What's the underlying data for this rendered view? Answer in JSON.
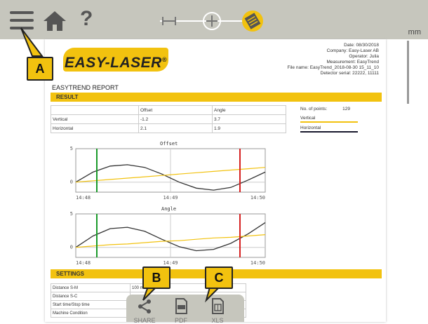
{
  "toolbar": {
    "menu_icon": "menu-icon",
    "home_icon": "home-icon",
    "help_label": "?",
    "unit": "mm"
  },
  "logo": {
    "text": "EASY-LASER",
    "reg": "®"
  },
  "header_info": {
    "date": "Date: 08/30/2018",
    "company": "Company: Easy-Laser AB",
    "operator": "Operator: Julia",
    "measurement": "Measurement: EasyTrend",
    "file": "File name: EasyTrend_2018-08-30 15_11_10",
    "serial": "Detector serial: 22222, 11111"
  },
  "report": {
    "title": "EASYTREND REPORT",
    "result_section": "RESULT",
    "settings_section": "SETTINGS"
  },
  "result_table": {
    "headers": [
      "",
      "Offset",
      "Angle"
    ],
    "rows": [
      [
        "Vertical",
        "-1.2",
        "3.7"
      ],
      [
        "Horizontal",
        "2.1",
        "1.9"
      ]
    ]
  },
  "points": {
    "label": "No. of points:",
    "value": "129",
    "legend_vertical": "Vertical",
    "legend_horizontal": "Horizontal",
    "vertical_color": "#f2c20f",
    "horizontal_color": "#1a1a2e"
  },
  "charts": {
    "offset_title": "Offset",
    "angle_title": "Angle",
    "y_ticks": [
      "5",
      "0"
    ],
    "x_ticks": [
      "14:48",
      "14:49",
      "14:50"
    ]
  },
  "chart_data": [
    {
      "type": "line",
      "title": "Offset",
      "xlabel": "",
      "ylabel": "",
      "x_ticks": [
        "14:48",
        "14:49",
        "14:50"
      ],
      "ylim": [
        -1.5,
        5
      ],
      "series": [
        {
          "values": [
            0.0,
            1.5,
            2.4,
            2.6,
            2.2,
            1.2,
            0.0,
            -0.9,
            -1.2,
            -0.8,
            0.3,
            1.5
          ],
          "color": "#333333"
        },
        {
          "values": [
            0.0,
            0.2,
            0.4,
            0.6,
            0.8,
            1.0,
            1.2,
            1.4,
            1.6,
            1.8,
            2.0,
            2.2
          ],
          "color": "#f2c20f"
        }
      ],
      "markers": {
        "green": "14:48",
        "red": "14:50"
      }
    },
    {
      "type": "line",
      "title": "Angle",
      "xlabel": "",
      "ylabel": "",
      "x_ticks": [
        "14:48",
        "14:49",
        "14:50"
      ],
      "ylim": [
        -1.5,
        5
      ],
      "series": [
        {
          "values": [
            0.0,
            1.7,
            2.8,
            3.0,
            2.4,
            1.2,
            0.1,
            -0.5,
            -0.3,
            0.6,
            2.0,
            3.7
          ],
          "color": "#333333"
        },
        {
          "values": [
            0.0,
            0.2,
            0.4,
            0.5,
            0.7,
            0.9,
            1.0,
            1.2,
            1.4,
            1.5,
            1.7,
            1.9
          ],
          "color": "#f2c20f"
        }
      ],
      "markers": {
        "green": "14:48",
        "red": "14:50"
      }
    }
  ],
  "settings_table": {
    "rows": [
      [
        "Distance S-M",
        "100 mm"
      ],
      [
        "Distance S-C",
        ""
      ],
      [
        "Start time/Stop time",
        ""
      ],
      [
        "Machine Condition",
        ""
      ]
    ]
  },
  "callouts": {
    "a": "A",
    "b": "B",
    "c": "C"
  },
  "sharebar": {
    "share_label": "SHARE",
    "pdf_label": "PDF",
    "xls_label": "XLS"
  },
  "colors": {
    "accent": "#f2c20f",
    "toolbar_bg": "#c6c6bd",
    "icon": "#555555"
  }
}
